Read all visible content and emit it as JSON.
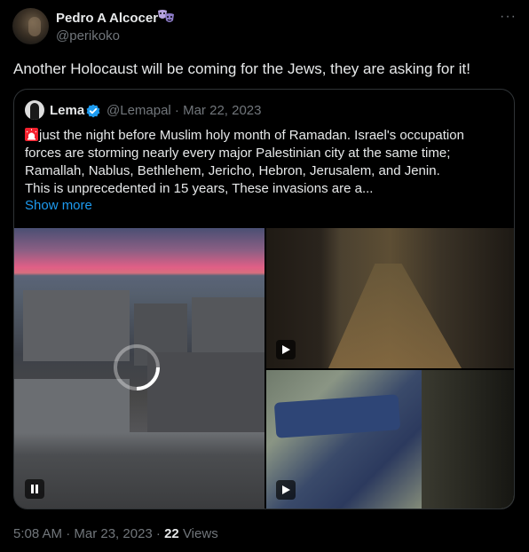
{
  "author": {
    "name": "Pedro A Alcocer",
    "badge_icon": "performing-arts-masks-icon",
    "handle": "@perikoko"
  },
  "tweet": {
    "text": "Another Holocaust will be coming for the Jews, they are asking for it!"
  },
  "quote": {
    "name": "Lema",
    "verified_icon": "verified-badge-icon",
    "handle_date": "@Lemapal · Mar 22, 2023",
    "lines": [
      "just the night before Muslim holy month of Ramadan. Israel's occupation",
      "forces are storming nearly every major Palestinian city at the same time;",
      "Ramallah, Nablus, Bethlehem, Jericho, Hebron, Jerusalem, and Jenin.",
      "This is unprecedented in 15 years, These invasions are a..."
    ],
    "lead_icon": "siren-icon",
    "show_more": "Show more",
    "media": [
      "video-city-dusk",
      "video-night-street",
      "video-blurry-window"
    ]
  },
  "meta": {
    "time_date": "5:08 AM · Mar 23, 2023 · ",
    "views_count": "22",
    "views_label": " Views"
  },
  "colors": {
    "background": "#000000",
    "text": "#e7e9ea",
    "secondary": "#71767b",
    "link": "#1d9bf0",
    "border": "#2f3336",
    "siren": "#f4212e"
  }
}
